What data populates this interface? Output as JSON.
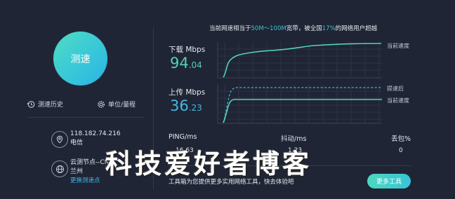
{
  "test_button": "测速",
  "history_link": "测速历史",
  "unit_link": "单位/量程",
  "ip": "118.182.74.216",
  "isp": "电信",
  "node_label": "云测节点--CN",
  "node_city": "兰州",
  "change_node": "更换测速点",
  "summary": {
    "prefix": "当前网速相当于",
    "range": "50M～100M",
    "mid": "宽带，被全国",
    "percent": "17%",
    "suffix": "的网络用户超越"
  },
  "download": {
    "label": "下载 Mbps",
    "int": "94",
    "dec": ".04"
  },
  "upload": {
    "label": "上传 Mbps",
    "int": "36",
    "dec": ".23"
  },
  "legend": {
    "current": "当前速度",
    "boost": "提速后"
  },
  "stats": {
    "ping_label": "PING/ms",
    "ping_value": "16.63",
    "jitter_label": "抖动/ms",
    "jitter_value": "1.23",
    "loss_label": "丢包%",
    "loss_value": "0"
  },
  "footer": "工具箱为您提供更多实用网络工具，快去体验吧",
  "more_tools": "更多工具",
  "watermark": "科技爱好者博客",
  "colors": {
    "accent_green": "#53d3b1",
    "accent_blue": "#43b9e4",
    "background": "#1f2535"
  }
}
